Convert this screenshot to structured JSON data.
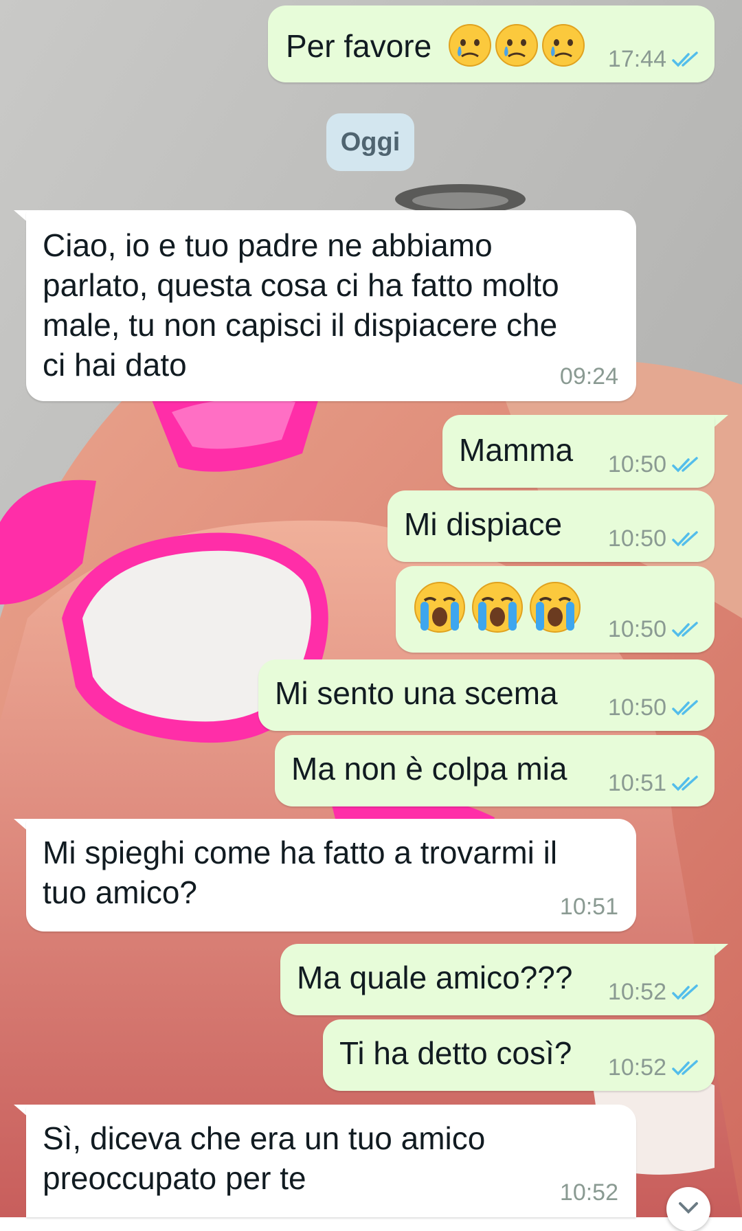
{
  "date_separator": "Oggi",
  "messages": [
    {
      "direction": "out",
      "text": "Per favore",
      "emojis": [
        "crying-face",
        "crying-face",
        "crying-face"
      ],
      "time": "17:44",
      "status": "read"
    },
    {
      "direction": "in",
      "text": "Ciao, io e tuo padre ne abbiamo\nparlato, questa cosa ci ha fatto molto\nmale, tu non capisci il dispiacere che\nci hai dato",
      "time": "09:24"
    },
    {
      "direction": "out",
      "text": "Mamma",
      "time": "10:50",
      "status": "read"
    },
    {
      "direction": "out",
      "text": "Mi dispiace",
      "time": "10:50",
      "status": "read"
    },
    {
      "direction": "out",
      "text": "",
      "emojis": [
        "loudly-crying-face",
        "loudly-crying-face",
        "loudly-crying-face"
      ],
      "time": "10:50",
      "status": "read"
    },
    {
      "direction": "out",
      "text": "Mi sento una scema",
      "time": "10:50",
      "status": "read"
    },
    {
      "direction": "out",
      "text": "Ma non è colpa mia",
      "time": "10:51",
      "status": "read"
    },
    {
      "direction": "in",
      "text": "Mi spieghi come ha fatto a trovarmi il\ntuo amico?",
      "time": "10:51"
    },
    {
      "direction": "out",
      "text": "Ma quale amico???",
      "time": "10:52",
      "status": "read"
    },
    {
      "direction": "out",
      "text": "Ti ha detto così?",
      "time": "10:52",
      "status": "read"
    },
    {
      "direction": "in",
      "text": "Sì, diceva che era un tuo amico\npreoccupato per te",
      "time": "10:52"
    }
  ],
  "colors": {
    "outgoing_bubble": "#e7fcd9",
    "incoming_bubble": "#ffffff",
    "read_ticks": "#53bdeb",
    "date_chip": "#d3e6ef"
  },
  "icons": {
    "read_receipt": "double-check-icon",
    "scroll_down": "chevron-down-icon"
  }
}
